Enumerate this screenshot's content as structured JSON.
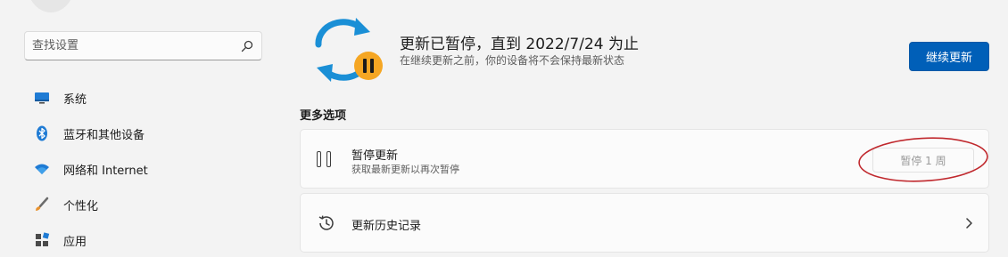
{
  "sidebar": {
    "search_placeholder": "查找设置",
    "items": [
      {
        "label": "系统",
        "icon": "monitor-icon"
      },
      {
        "label": "蓝牙和其他设备",
        "icon": "bluetooth-icon"
      },
      {
        "label": "网络和 Internet",
        "icon": "wifi-icon"
      },
      {
        "label": "个性化",
        "icon": "brush-icon"
      },
      {
        "label": "应用",
        "icon": "apps-icon"
      }
    ]
  },
  "main": {
    "status_title": "更新已暂停，直到 2022/7/24 为止",
    "status_subtitle": "在继续更新之前，你的设备将不会保持最新状态",
    "resume_button": "继续更新",
    "section_title": "更多选项",
    "pause_card": {
      "title": "暂停更新",
      "subtitle": "获取最新更新以再次暂停",
      "select_value": "暂停 1 周"
    },
    "history_card": {
      "title": "更新历史记录"
    }
  },
  "colors": {
    "accent": "#005fb8",
    "sync_blue": "#1a8fd6",
    "pause_badge": "#f5a623",
    "annotation": "#c0282d"
  }
}
